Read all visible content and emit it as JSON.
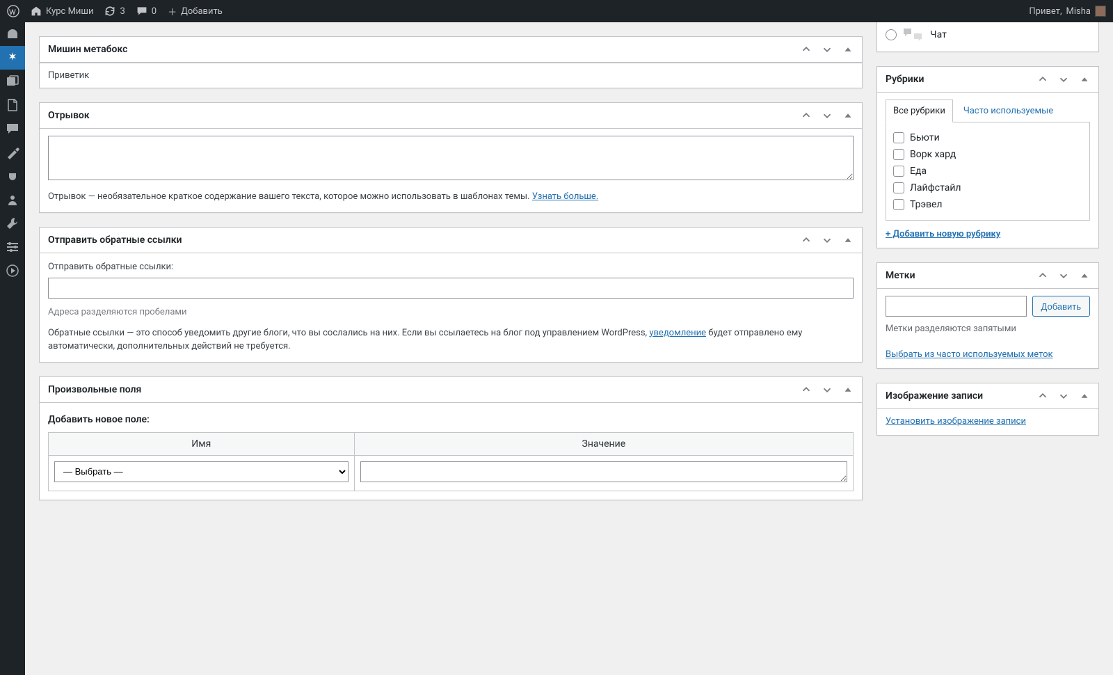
{
  "adminbar": {
    "site_name": "Курс Миши",
    "updates_count": "3",
    "comments_count": "0",
    "add_new": "Добавить",
    "howdy": "Привет,",
    "username": "Misha"
  },
  "metabox_mishin": {
    "title": "Мишин метабокс",
    "content": "Приветик"
  },
  "metabox_excerpt": {
    "title": "Отрывок",
    "value": "",
    "desc_prefix": "Отрывок — необязательное краткое содержание вашего текста, которое можно использовать в шаблонах темы. ",
    "learn_more": "Узнать больше."
  },
  "metabox_trackbacks": {
    "title": "Отправить обратные ссылки",
    "label": "Отправить обратные ссылки:",
    "value": "",
    "separator_desc": "Адреса разделяются пробелами",
    "desc_prefix": "Обратные ссылки — это способ уведомить другие блоги, что вы сослались на них. Если вы ссылаетесь на блог под управлением WordPress, ",
    "link_word": "уведомление",
    "desc_suffix": " будет отправлено ему автоматически, дополнительных действий не требуется."
  },
  "metabox_customfields": {
    "title": "Произвольные поля",
    "heading": "Добавить новое поле:",
    "col_name": "Имя",
    "col_value": "Значение",
    "select_placeholder": "— Выбрать —"
  },
  "side_chat": {
    "label": "Чат"
  },
  "side_categories": {
    "title": "Рубрики",
    "tab_all": "Все рубрики",
    "tab_popular": "Часто используемые",
    "items": [
      "Бьюти",
      "Ворк хард",
      "Еда",
      "Лайфстайл",
      "Трэвел"
    ],
    "add_new": "+ Добавить новую рубрику"
  },
  "side_tags": {
    "title": "Метки",
    "button": "Добавить",
    "desc": "Метки разделяются запятыми",
    "popular_link": "Выбрать из часто используемых меток"
  },
  "side_featured": {
    "title": "Изображение записи",
    "link": "Установить изображение записи"
  }
}
